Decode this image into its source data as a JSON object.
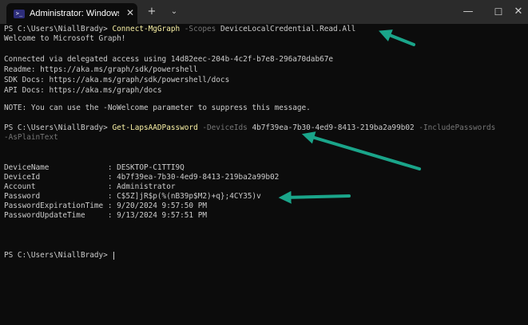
{
  "window": {
    "tab_title": "Administrator: Windows PowerShell",
    "tab_icon": "powershell-icon",
    "new_tab": "+",
    "dropdown": "⌄",
    "minimize": "—",
    "maximize": "☐",
    "close": "✕",
    "tab_close": "✕"
  },
  "terminal": {
    "l1": {
      "prompt": "PS C:\\Users\\NiallBrady> ",
      "cmd": "Connect-MgGraph",
      "param": " -Scopes",
      "arg": " DeviceLocalCredential.Read.All"
    },
    "l2": "Welcome to Microsoft Graph!",
    "l3": "Connected via delegated access using 14d82eec-204b-4c2f-b7e8-296a70dab67e",
    "l4": "Readme: https://aka.ms/graph/sdk/powershell",
    "l5": "SDK Docs: https://aka.ms/graph/sdk/powershell/docs",
    "l6": "API Docs: https://aka.ms/graph/docs",
    "l7": "NOTE: You can use the -NoWelcome parameter to suppress this message.",
    "l8": {
      "prompt": "PS C:\\Users\\NiallBrady> ",
      "cmd": "Get-LapsAADPassword",
      "param1": " -DeviceIds",
      "arg1": " 4b7f39ea-7b30-4ed9-8413-219ba2a99b02",
      "param2": " -IncludePasswords"
    },
    "l9": "-AsPlainText",
    "results": [
      "DeviceName             : DESKTOP-C1TTI9Q",
      "DeviceId               : 4b7f39ea-7b30-4ed9-8413-219ba2a99b02",
      "Account                : Administrator",
      "Password               : C$5Z]jR$p(%(nB39p$M2)+q};4CY35)v",
      "PasswordExpirationTime : 9/20/2024 9:57:50 PM",
      "PasswordUpdateTime     : 9/13/2024 9:57:51 PM"
    ],
    "final_prompt": "PS C:\\Users\\NiallBrady> "
  },
  "colors": {
    "background": "#0c0c0c",
    "text": "#cccccc",
    "command": "#f9f1a5",
    "parameter": "#767676",
    "annotation_arrow": "#1aa58a"
  }
}
